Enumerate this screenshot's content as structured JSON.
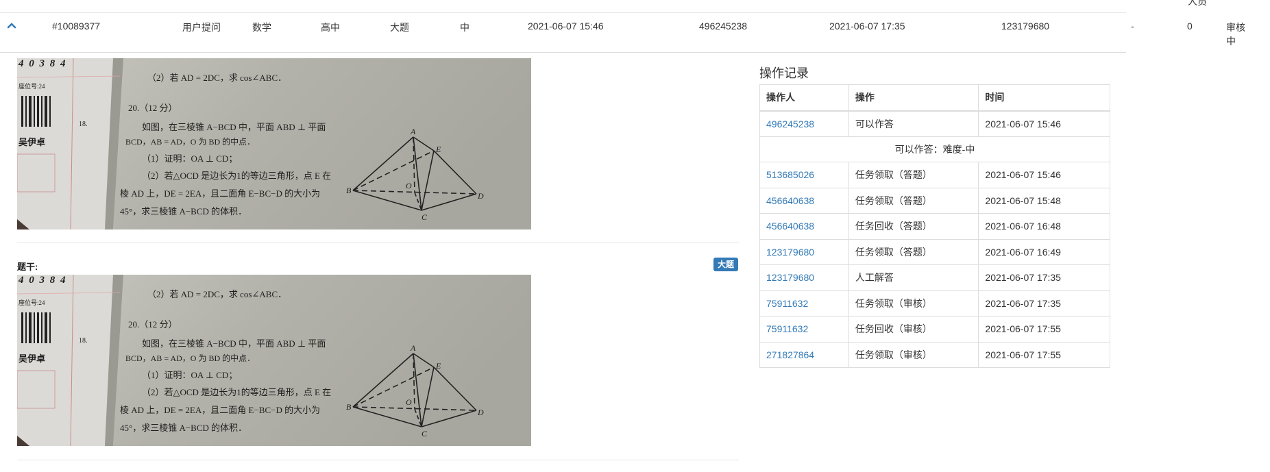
{
  "header_clip": "人员",
  "record_row": {
    "id": "#10089377",
    "source": "用户提问",
    "subject": "数学",
    "grade": "高中",
    "question_type": "大题",
    "difficulty": "中",
    "created_time": "2021-06-07 15:46",
    "creator": "496245238",
    "answer_time": "2021-06-07 17:35",
    "answerer": "123179680",
    "dash": "-",
    "count": "0",
    "status": "审核中"
  },
  "stem": {
    "label": "题干:",
    "badge": "大题"
  },
  "photo_text": {
    "header_marks": "4 0 3 8 4",
    "part2": "（2）若 AD = 2DC，求 cos∠ABC．",
    "q_number": "20.（12 分）",
    "line1": "如图，在三棱锥 A−BCD 中，平面 ABD ⊥ 平面",
    "line2": "BCD，AB = AD，O 为 BD 的中点．",
    "line3": "（1）证明：OA ⊥ CD；",
    "line4": "（2）若△OCD 是边长为1的等边三角形，点 E 在",
    "line5": "棱 AD 上，DE = 2EA，且二面角 E−BC−D 的大小为",
    "line6": "45°，求三棱锥 A−BCD 的体积．",
    "seat": "座位号:24",
    "num18": "18.",
    "name": "吴伊卓",
    "label_a": "A",
    "label_b": "B",
    "label_c": "C",
    "label_d": "D",
    "label_e": "E",
    "label_o": "O"
  },
  "log": {
    "title": "操作记录",
    "headers": [
      "操作人",
      "操作",
      "时间"
    ],
    "rows": [
      {
        "operator": "496245238",
        "action": "可以作答",
        "time": "2021-06-07 15:46"
      },
      {
        "note": "可以作答：难度-中"
      },
      {
        "operator": "513685026",
        "action": "任务领取（答题）",
        "time": "2021-06-07 15:46"
      },
      {
        "operator": "456640638",
        "action": "任务领取（答题）",
        "time": "2021-06-07 15:48"
      },
      {
        "operator": "456640638",
        "action": "任务回收（答题）",
        "time": "2021-06-07 16:48"
      },
      {
        "operator": "123179680",
        "action": "任务领取（答题）",
        "time": "2021-06-07 16:49"
      },
      {
        "operator": "123179680",
        "action": "人工解答",
        "time": "2021-06-07 17:35"
      },
      {
        "operator": "75911632",
        "action": "任务领取（审核）",
        "time": "2021-06-07 17:35"
      },
      {
        "operator": "75911632",
        "action": "任务回收（审核）",
        "time": "2021-06-07 17:55"
      },
      {
        "operator": "271827864",
        "action": "任务领取（审核）",
        "time": "2021-06-07 17:55"
      }
    ]
  },
  "colors": {
    "link": "#337ab7",
    "badge_bg": "#337ab7",
    "border": "#dddddd",
    "photo_bg": "#b9b8b1"
  }
}
